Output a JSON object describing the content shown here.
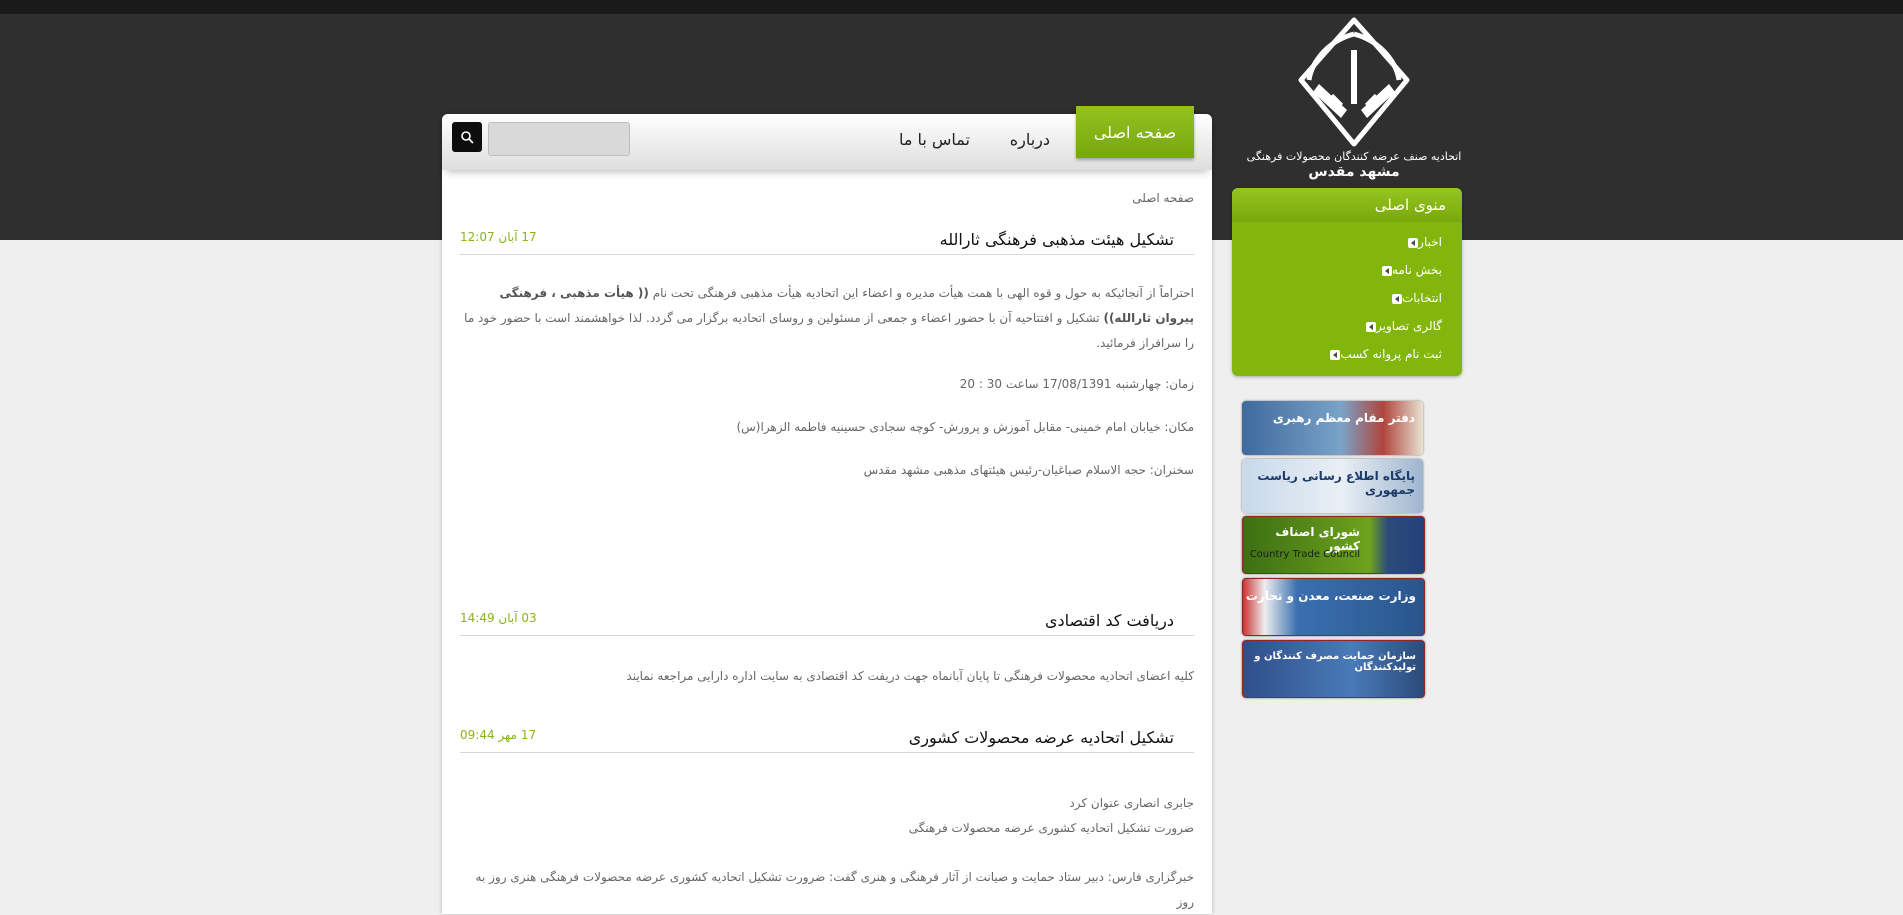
{
  "logo": {
    "line1": "اتحادیه صنف عرضه کنندگان محصولات فرهنگی",
    "line2": "مشهد مقدس"
  },
  "nav": {
    "home": "صفحه اصلی",
    "about": "درباره",
    "contact": "تماس با ما",
    "search_placeholder": ""
  },
  "breadcrumb": "صفحه اصلی",
  "articles": [
    {
      "title": "تشکیل هیئت مذهبی فرهنگی ثارالله",
      "date": "17 آبان 12:07",
      "body_a": "احتراماً از آنجائیکه به حول و قوه الهی با همت هیأت مدیره و اعضاء این اتحادیه هیأت مذهبی فرهنگی تحت نام ",
      "body_b": "(( هیأت مذهبی ، فرهنگی پیروان ثارالله))",
      "body_c": " تشکیل و افتتاحیه آن با حضور اعضاء و جمعی از مسئولین و روسای اتحادیه برگزار می گردد. لذا خواهشمند است با حضور خود ما را سرافراز فرمائید.",
      "time": "زمان: چهارشنبه 17/08/1391 ساعت  30 : 20",
      "place": "مکان: خیابان امام خمینی- مقابل آموزش و پرورش- کوچه سجادی حسینیه فاطمه الزهرا(س)",
      "speakers": "سخنران: حجه الاسلام صباغیان-رئیس هیئتهای مذهبی مشهد مقدس"
    },
    {
      "title": "دریافت کد اقتصادی",
      "date": "03 آبان 14:49",
      "body": "کلیه اعضای اتحادیه محصولات فرهنگی تا پایان آبانماه جهت دریفت کد اقتصادی به سایت اداره دارایی مراجعه نمایند"
    },
    {
      "title": "تشکیل اتحادیه عرضه محصولات کشوری",
      "date": "17 مهر 09:44",
      "line1": "جابری انصاری عنوان کرد",
      "line2": "ضرورت تشکیل اتحادیه کشوری عرضه محصولات فرهنگی",
      "line3": "خبرگزاری فارس: دبیر ستاد حمایت و صیانت از آثار فرهنگی و هنری گفت: ضرورت تشکیل اتحادیه کشوری عرضه محصولات فرهنگی هنری روز به روز"
    }
  ],
  "sidebar": {
    "title": "منوی اصلی",
    "items": [
      "اخبار",
      "بخش نامه",
      "انتخابات",
      "گالری تصاویر",
      "ثبت نام پروانه کسب"
    ]
  },
  "banners": [
    {
      "title": "دفتر مقام معظم رهبری",
      "sub": ""
    },
    {
      "title": "پایگاه اطلاع رسانی ریاست جمهوری",
      "sub": ""
    },
    {
      "title": "شورای اصناف کشور",
      "sub": "Country Trade Council"
    },
    {
      "title": "وزارت صنعت، معدن و تجارت",
      "sub": ""
    },
    {
      "title": "سازمان حمایت مصرف کنندگان و تولیدکنندگان",
      "sub": ""
    }
  ],
  "colors": {
    "accent": "#82b60c",
    "date": "#8ab31a",
    "header": "#2f2f2f"
  }
}
